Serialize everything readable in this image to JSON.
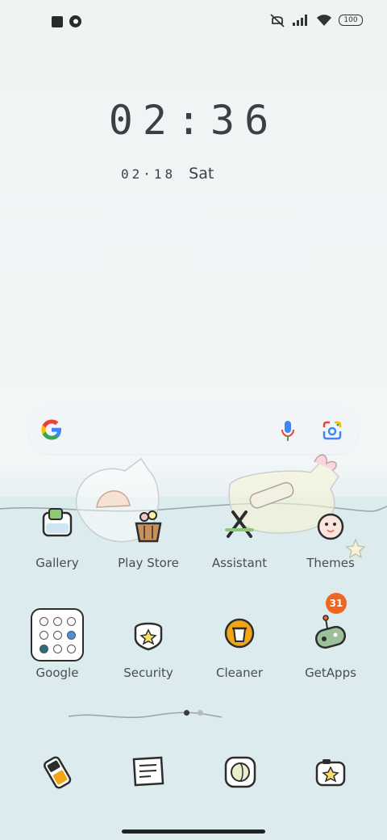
{
  "status_bar": {
    "battery": "100",
    "icons": [
      "notification-square-icon",
      "app-notification-icon",
      "silent-icon",
      "signal-icon",
      "wifi-icon",
      "battery-icon"
    ]
  },
  "lockclock": {
    "time": "02:36",
    "date": "02·18",
    "day": "Sat"
  },
  "search": {
    "icons": [
      "google-logo-icon",
      "microphone-icon",
      "google-lens-icon"
    ]
  },
  "apps_row1": [
    {
      "label": "Gallery",
      "icon": "gallery-icon"
    },
    {
      "label": "Play Store",
      "icon": "play-store-icon"
    },
    {
      "label": "Assistant",
      "icon": "assistant-icon"
    },
    {
      "label": "Themes",
      "icon": "themes-icon"
    }
  ],
  "apps_row2": [
    {
      "label": "Google",
      "icon": "google-folder-icon"
    },
    {
      "label": "Security",
      "icon": "security-icon"
    },
    {
      "label": "Cleaner",
      "icon": "cleaner-icon"
    },
    {
      "label": "GetApps",
      "icon": "getapps-icon",
      "badge": "31"
    }
  ],
  "page_indicator": {
    "pages": 2,
    "current": 1
  },
  "dock": [
    {
      "icon": "phone-icon"
    },
    {
      "icon": "messages-icon"
    },
    {
      "icon": "browser-icon"
    },
    {
      "icon": "camera-icon"
    }
  ],
  "colors": {
    "badge": "#f0651f",
    "water": "#dcebee",
    "background": "#eef3f4"
  }
}
